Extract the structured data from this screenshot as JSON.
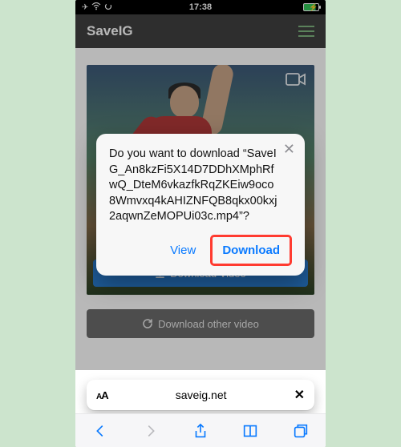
{
  "status": {
    "time": "17:38"
  },
  "header": {
    "brand": "SaveIG"
  },
  "video": {
    "download_label": "Download Video"
  },
  "other_button": {
    "label": "Download other video"
  },
  "modal": {
    "message": "Do you want to download “SaveIG_An8kzFi5X14D7DDhXMphRfwQ_DteM6vkazfkRqZKEiw9oco8Wmvxq4kAHIZNFQB8qkx00kxj2aqwnZeMOPUi03c.mp4”?",
    "view_label": "View",
    "download_label": "Download"
  },
  "url_bar": {
    "domain": "saveig.net"
  }
}
